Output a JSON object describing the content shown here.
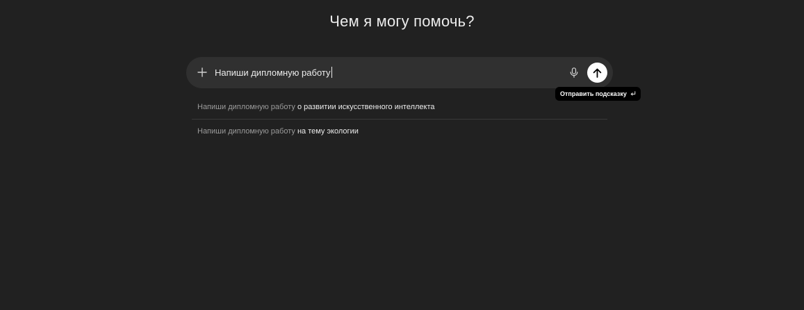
{
  "heading": {
    "title": "Чем я могу помочь?"
  },
  "composer": {
    "input_value": "Напиши дипломную работу",
    "plus_icon": "plus-icon",
    "mic_icon": "microphone-icon",
    "send_icon": "arrow-up-icon"
  },
  "tooltip": {
    "label": "Отправить подсказку",
    "icon": "return-key-icon"
  },
  "suggestions": [
    {
      "prefix": "Напиши дипломную работу",
      "rest": " о развитии искусственного интеллекта"
    },
    {
      "prefix": "Напиши дипломную работу",
      "rest": " на тему экологии"
    }
  ],
  "colors": {
    "background": "#212121",
    "composer": "#303030",
    "send_button": "#ffffff",
    "tooltip": "#000000",
    "muted_text": "#9b9b9b"
  }
}
